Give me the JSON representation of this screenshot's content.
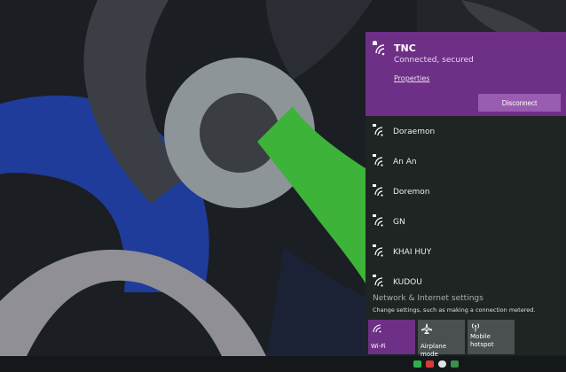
{
  "connected_network": {
    "name": "TNC",
    "status": "Connected, secured",
    "properties_link": "Properties",
    "disconnect_label": "Disconnect"
  },
  "networks": [
    {
      "name": "Doraemon"
    },
    {
      "name": "An An"
    },
    {
      "name": "Doremon"
    },
    {
      "name": "GN"
    },
    {
      "name": "KHAI HUY"
    },
    {
      "name": "KUDOU"
    }
  ],
  "settings": {
    "title": "Network & Internet settings",
    "subtitle": "Change settings, such as making a connection metered."
  },
  "quick_actions": [
    {
      "label": "Wi-Fi",
      "icon": "wifi-icon",
      "active": true
    },
    {
      "label": "Airplane mode",
      "icon": "airplane-icon",
      "active": false
    },
    {
      "label": "Mobile hotspot",
      "icon": "hotspot-icon",
      "active": false
    }
  ],
  "colors": {
    "accent": "#6e2f86",
    "disconnect_button": "#9a5cb0"
  },
  "tray_icons": [
    "nvidia-icon",
    "vivaldi-icon",
    "onedrive-icon",
    "network-icon"
  ]
}
